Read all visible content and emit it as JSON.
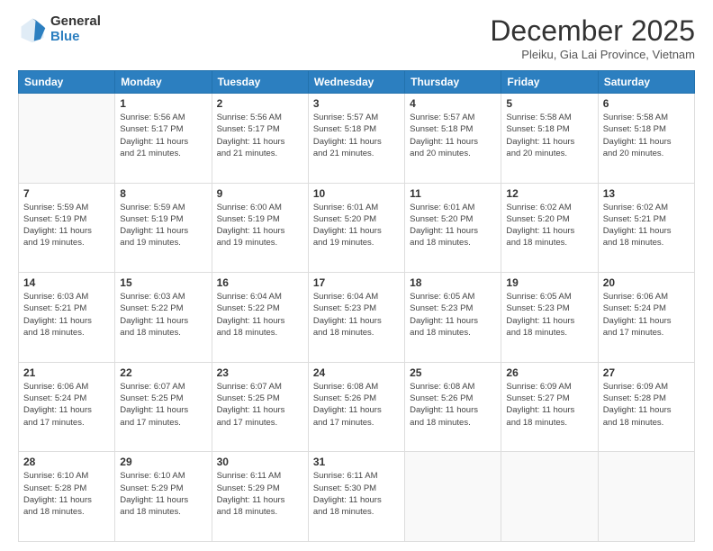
{
  "header": {
    "logo_general": "General",
    "logo_blue": "Blue",
    "month_title": "December 2025",
    "location": "Pleiku, Gia Lai Province, Vietnam"
  },
  "days_of_week": [
    "Sunday",
    "Monday",
    "Tuesday",
    "Wednesday",
    "Thursday",
    "Friday",
    "Saturday"
  ],
  "weeks": [
    [
      {
        "day": "",
        "info": ""
      },
      {
        "day": "1",
        "info": "Sunrise: 5:56 AM\nSunset: 5:17 PM\nDaylight: 11 hours\nand 21 minutes."
      },
      {
        "day": "2",
        "info": "Sunrise: 5:56 AM\nSunset: 5:17 PM\nDaylight: 11 hours\nand 21 minutes."
      },
      {
        "day": "3",
        "info": "Sunrise: 5:57 AM\nSunset: 5:18 PM\nDaylight: 11 hours\nand 21 minutes."
      },
      {
        "day": "4",
        "info": "Sunrise: 5:57 AM\nSunset: 5:18 PM\nDaylight: 11 hours\nand 20 minutes."
      },
      {
        "day": "5",
        "info": "Sunrise: 5:58 AM\nSunset: 5:18 PM\nDaylight: 11 hours\nand 20 minutes."
      },
      {
        "day": "6",
        "info": "Sunrise: 5:58 AM\nSunset: 5:18 PM\nDaylight: 11 hours\nand 20 minutes."
      }
    ],
    [
      {
        "day": "7",
        "info": "Sunrise: 5:59 AM\nSunset: 5:19 PM\nDaylight: 11 hours\nand 19 minutes."
      },
      {
        "day": "8",
        "info": "Sunrise: 5:59 AM\nSunset: 5:19 PM\nDaylight: 11 hours\nand 19 minutes."
      },
      {
        "day": "9",
        "info": "Sunrise: 6:00 AM\nSunset: 5:19 PM\nDaylight: 11 hours\nand 19 minutes."
      },
      {
        "day": "10",
        "info": "Sunrise: 6:01 AM\nSunset: 5:20 PM\nDaylight: 11 hours\nand 19 minutes."
      },
      {
        "day": "11",
        "info": "Sunrise: 6:01 AM\nSunset: 5:20 PM\nDaylight: 11 hours\nand 18 minutes."
      },
      {
        "day": "12",
        "info": "Sunrise: 6:02 AM\nSunset: 5:20 PM\nDaylight: 11 hours\nand 18 minutes."
      },
      {
        "day": "13",
        "info": "Sunrise: 6:02 AM\nSunset: 5:21 PM\nDaylight: 11 hours\nand 18 minutes."
      }
    ],
    [
      {
        "day": "14",
        "info": "Sunrise: 6:03 AM\nSunset: 5:21 PM\nDaylight: 11 hours\nand 18 minutes."
      },
      {
        "day": "15",
        "info": "Sunrise: 6:03 AM\nSunset: 5:22 PM\nDaylight: 11 hours\nand 18 minutes."
      },
      {
        "day": "16",
        "info": "Sunrise: 6:04 AM\nSunset: 5:22 PM\nDaylight: 11 hours\nand 18 minutes."
      },
      {
        "day": "17",
        "info": "Sunrise: 6:04 AM\nSunset: 5:23 PM\nDaylight: 11 hours\nand 18 minutes."
      },
      {
        "day": "18",
        "info": "Sunrise: 6:05 AM\nSunset: 5:23 PM\nDaylight: 11 hours\nand 18 minutes."
      },
      {
        "day": "19",
        "info": "Sunrise: 6:05 AM\nSunset: 5:23 PM\nDaylight: 11 hours\nand 18 minutes."
      },
      {
        "day": "20",
        "info": "Sunrise: 6:06 AM\nSunset: 5:24 PM\nDaylight: 11 hours\nand 17 minutes."
      }
    ],
    [
      {
        "day": "21",
        "info": "Sunrise: 6:06 AM\nSunset: 5:24 PM\nDaylight: 11 hours\nand 17 minutes."
      },
      {
        "day": "22",
        "info": "Sunrise: 6:07 AM\nSunset: 5:25 PM\nDaylight: 11 hours\nand 17 minutes."
      },
      {
        "day": "23",
        "info": "Sunrise: 6:07 AM\nSunset: 5:25 PM\nDaylight: 11 hours\nand 17 minutes."
      },
      {
        "day": "24",
        "info": "Sunrise: 6:08 AM\nSunset: 5:26 PM\nDaylight: 11 hours\nand 17 minutes."
      },
      {
        "day": "25",
        "info": "Sunrise: 6:08 AM\nSunset: 5:26 PM\nDaylight: 11 hours\nand 18 minutes."
      },
      {
        "day": "26",
        "info": "Sunrise: 6:09 AM\nSunset: 5:27 PM\nDaylight: 11 hours\nand 18 minutes."
      },
      {
        "day": "27",
        "info": "Sunrise: 6:09 AM\nSunset: 5:28 PM\nDaylight: 11 hours\nand 18 minutes."
      }
    ],
    [
      {
        "day": "28",
        "info": "Sunrise: 6:10 AM\nSunset: 5:28 PM\nDaylight: 11 hours\nand 18 minutes."
      },
      {
        "day": "29",
        "info": "Sunrise: 6:10 AM\nSunset: 5:29 PM\nDaylight: 11 hours\nand 18 minutes."
      },
      {
        "day": "30",
        "info": "Sunrise: 6:11 AM\nSunset: 5:29 PM\nDaylight: 11 hours\nand 18 minutes."
      },
      {
        "day": "31",
        "info": "Sunrise: 6:11 AM\nSunset: 5:30 PM\nDaylight: 11 hours\nand 18 minutes."
      },
      {
        "day": "",
        "info": ""
      },
      {
        "day": "",
        "info": ""
      },
      {
        "day": "",
        "info": ""
      }
    ]
  ]
}
